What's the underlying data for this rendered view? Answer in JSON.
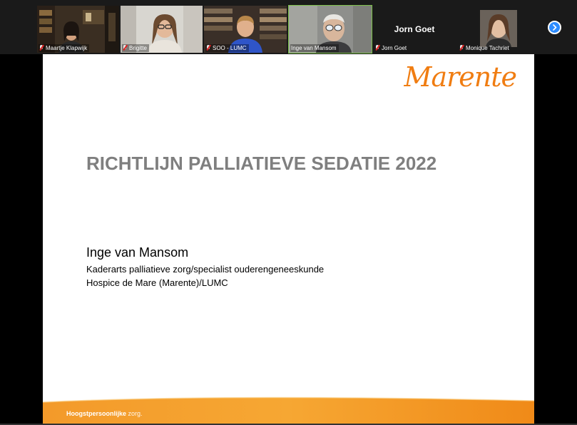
{
  "participants": [
    {
      "name": "Maartje Klapwijk",
      "muted": true
    },
    {
      "name": "Brigitte",
      "muted": true
    },
    {
      "name": "SOO - LUMC",
      "muted": true
    },
    {
      "name": "Inge van Mansom",
      "muted": false,
      "active": true
    },
    {
      "name": "Jorn Goet",
      "display_name": "Jorn Goet",
      "muted": true,
      "video": false
    },
    {
      "name": "Monique Tachriet",
      "muted": true
    }
  ],
  "gallery": {
    "next_icon": "chevron-right-icon"
  },
  "slide": {
    "logo": "Marente",
    "title": "RICHTLIJN PALLIATIEVE SEDATIE 2022",
    "presenter": "Inge van Mansom",
    "role": "Kaderarts palliatieve zorg/specialist ouderengeneeskunde",
    "organization": "Hospice de Mare (Marente)/LUMC",
    "tagline_bold": "Hoogstpersoonlijke",
    "tagline_light": "zorg."
  },
  "colors": {
    "brand": "#f07d12",
    "title": "#7f7f7f",
    "zoom_blue": "#2d8cff"
  }
}
